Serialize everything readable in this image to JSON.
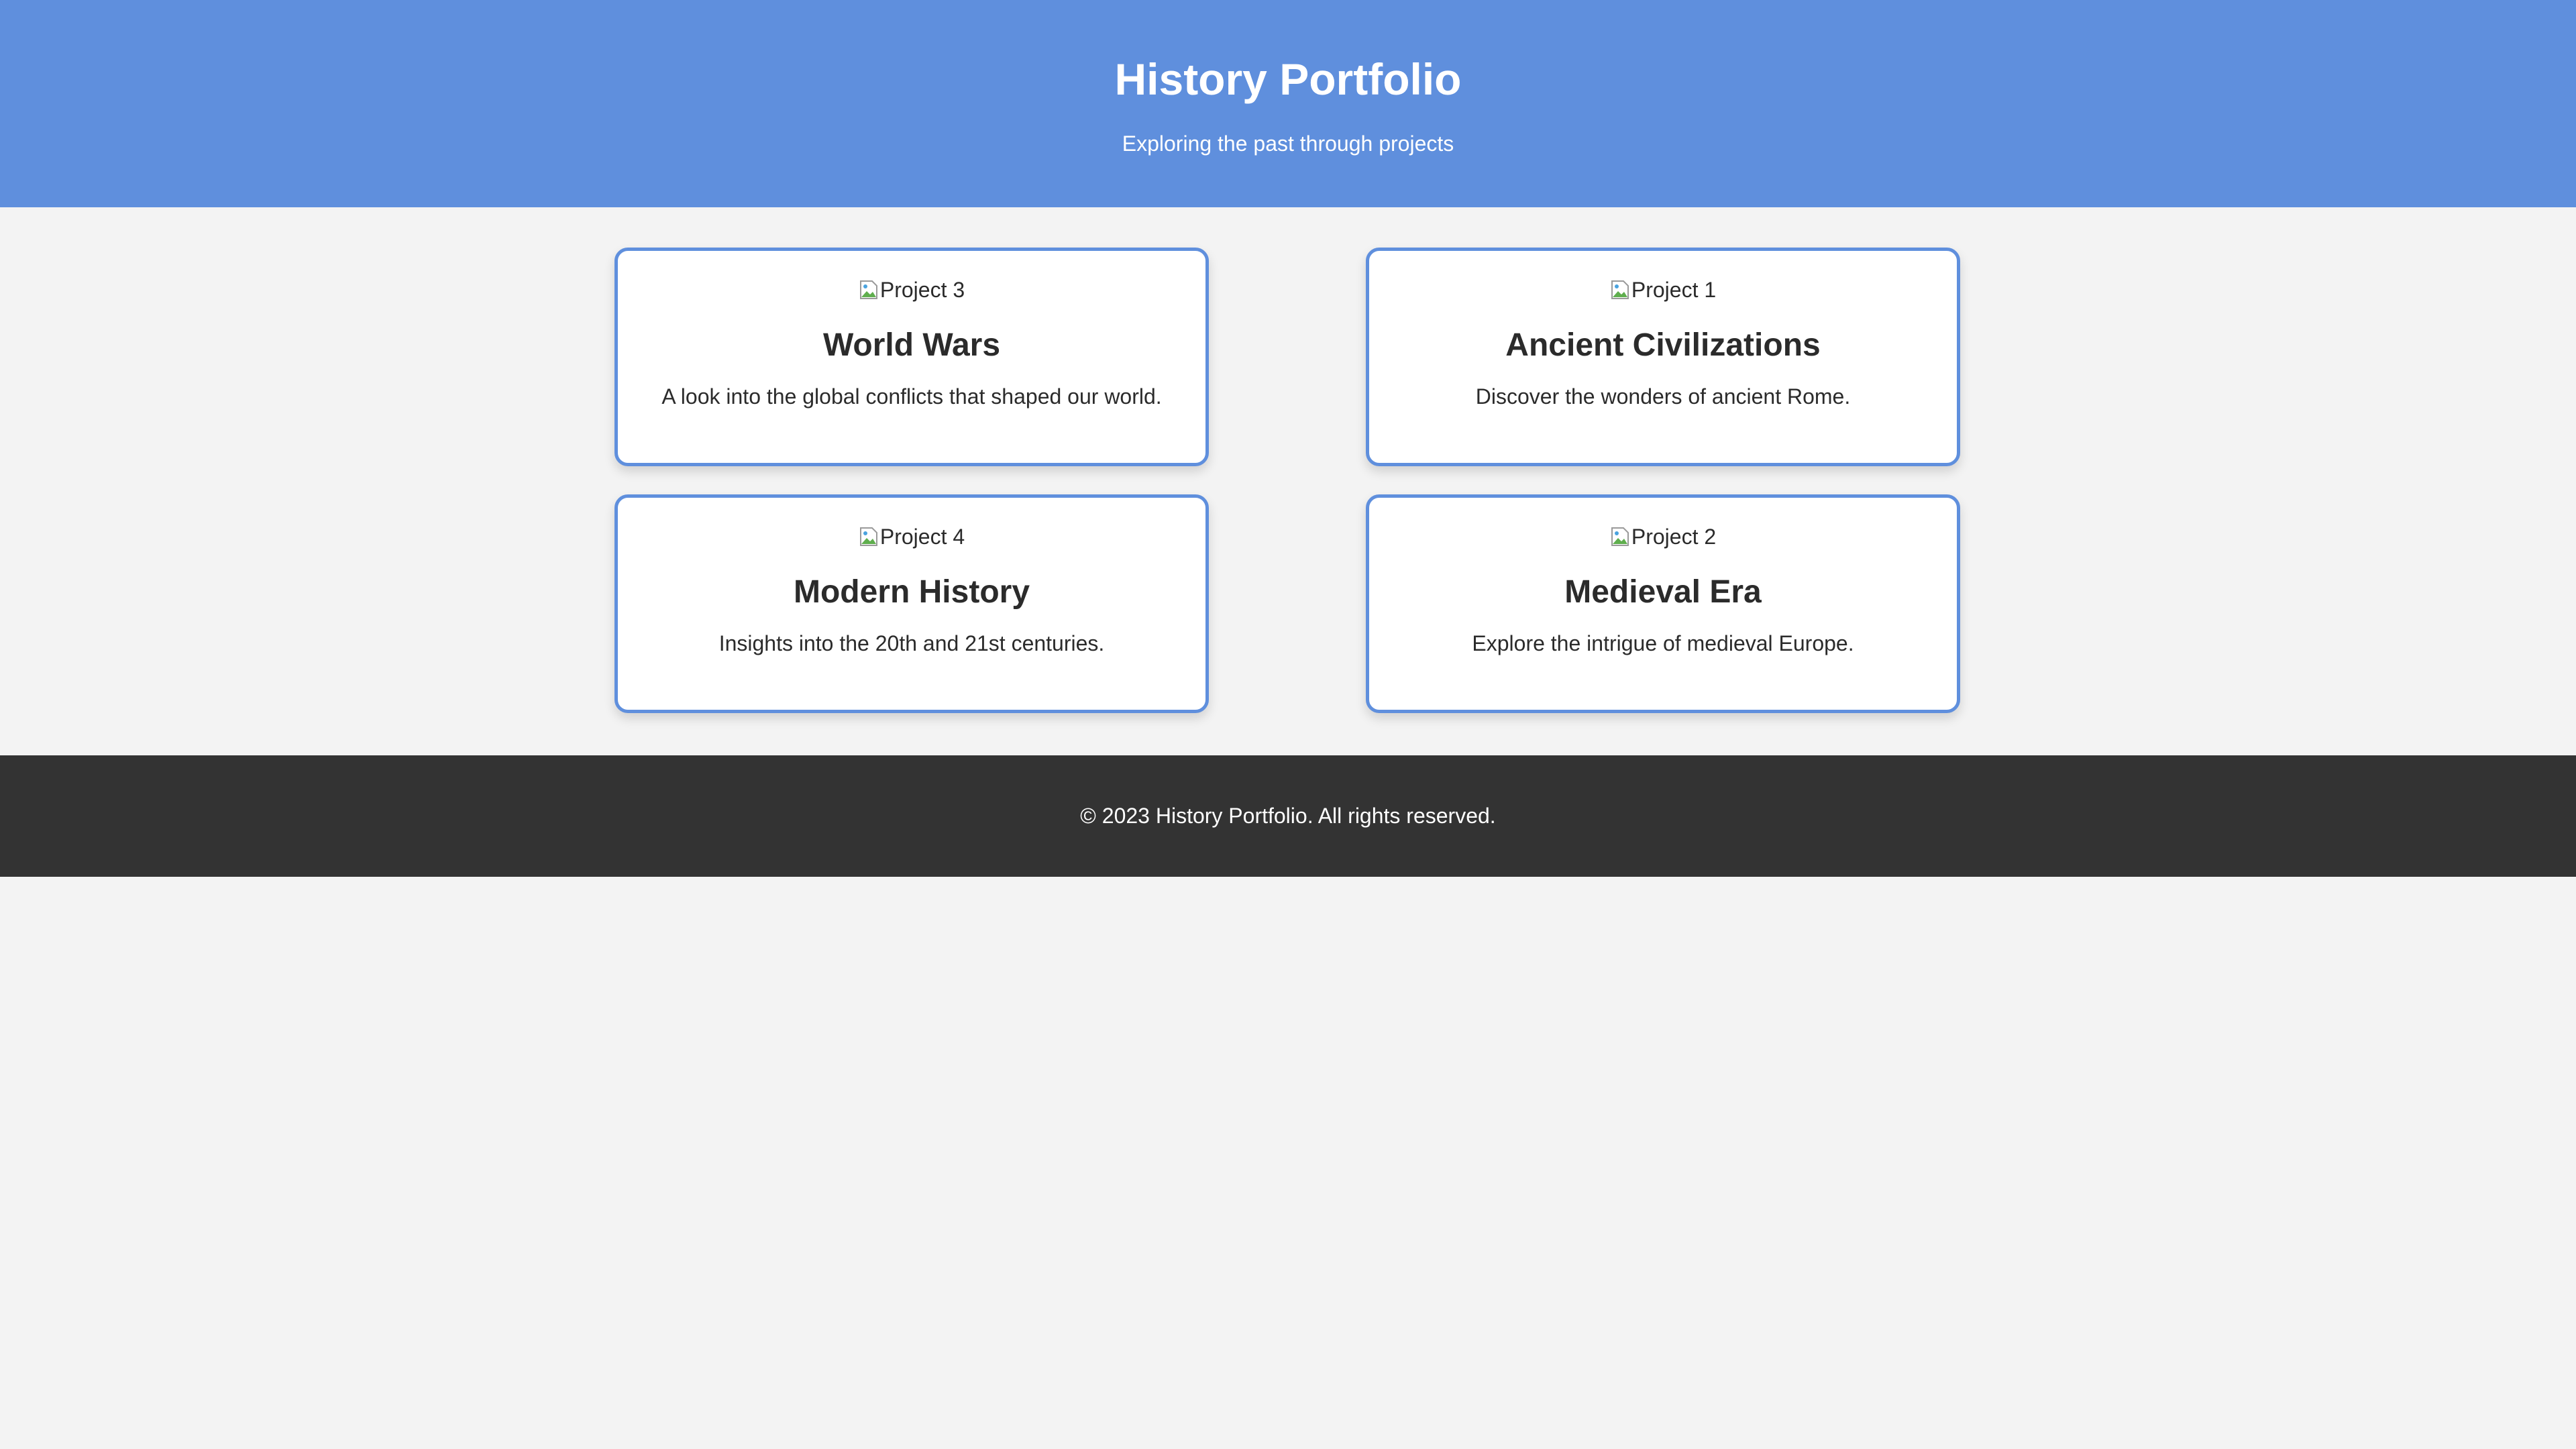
{
  "header": {
    "title": "History Portfolio",
    "subtitle": "Exploring the past through projects"
  },
  "projects": [
    {
      "image_alt": "Project 3",
      "title": "World Wars",
      "description": "A look into the global conflicts that shaped our world."
    },
    {
      "image_alt": "Project 1",
      "title": "Ancient Civilizations",
      "description": "Discover the wonders of ancient Rome."
    },
    {
      "image_alt": "Project 4",
      "title": "Modern History",
      "description": "Insights into the 20th and 21st centuries."
    },
    {
      "image_alt": "Project 2",
      "title": "Medieval Era",
      "description": "Explore the intrigue of medieval Europe."
    }
  ],
  "footer": {
    "copyright": "© 2023 History Portfolio. All rights reserved."
  },
  "colors": {
    "header_bg": "#5f8fdd",
    "card_border": "#5f8fdd",
    "page_bg": "#f3f3f3",
    "footer_bg": "#333333"
  },
  "icons": {
    "card_image": "broken-image-icon"
  }
}
